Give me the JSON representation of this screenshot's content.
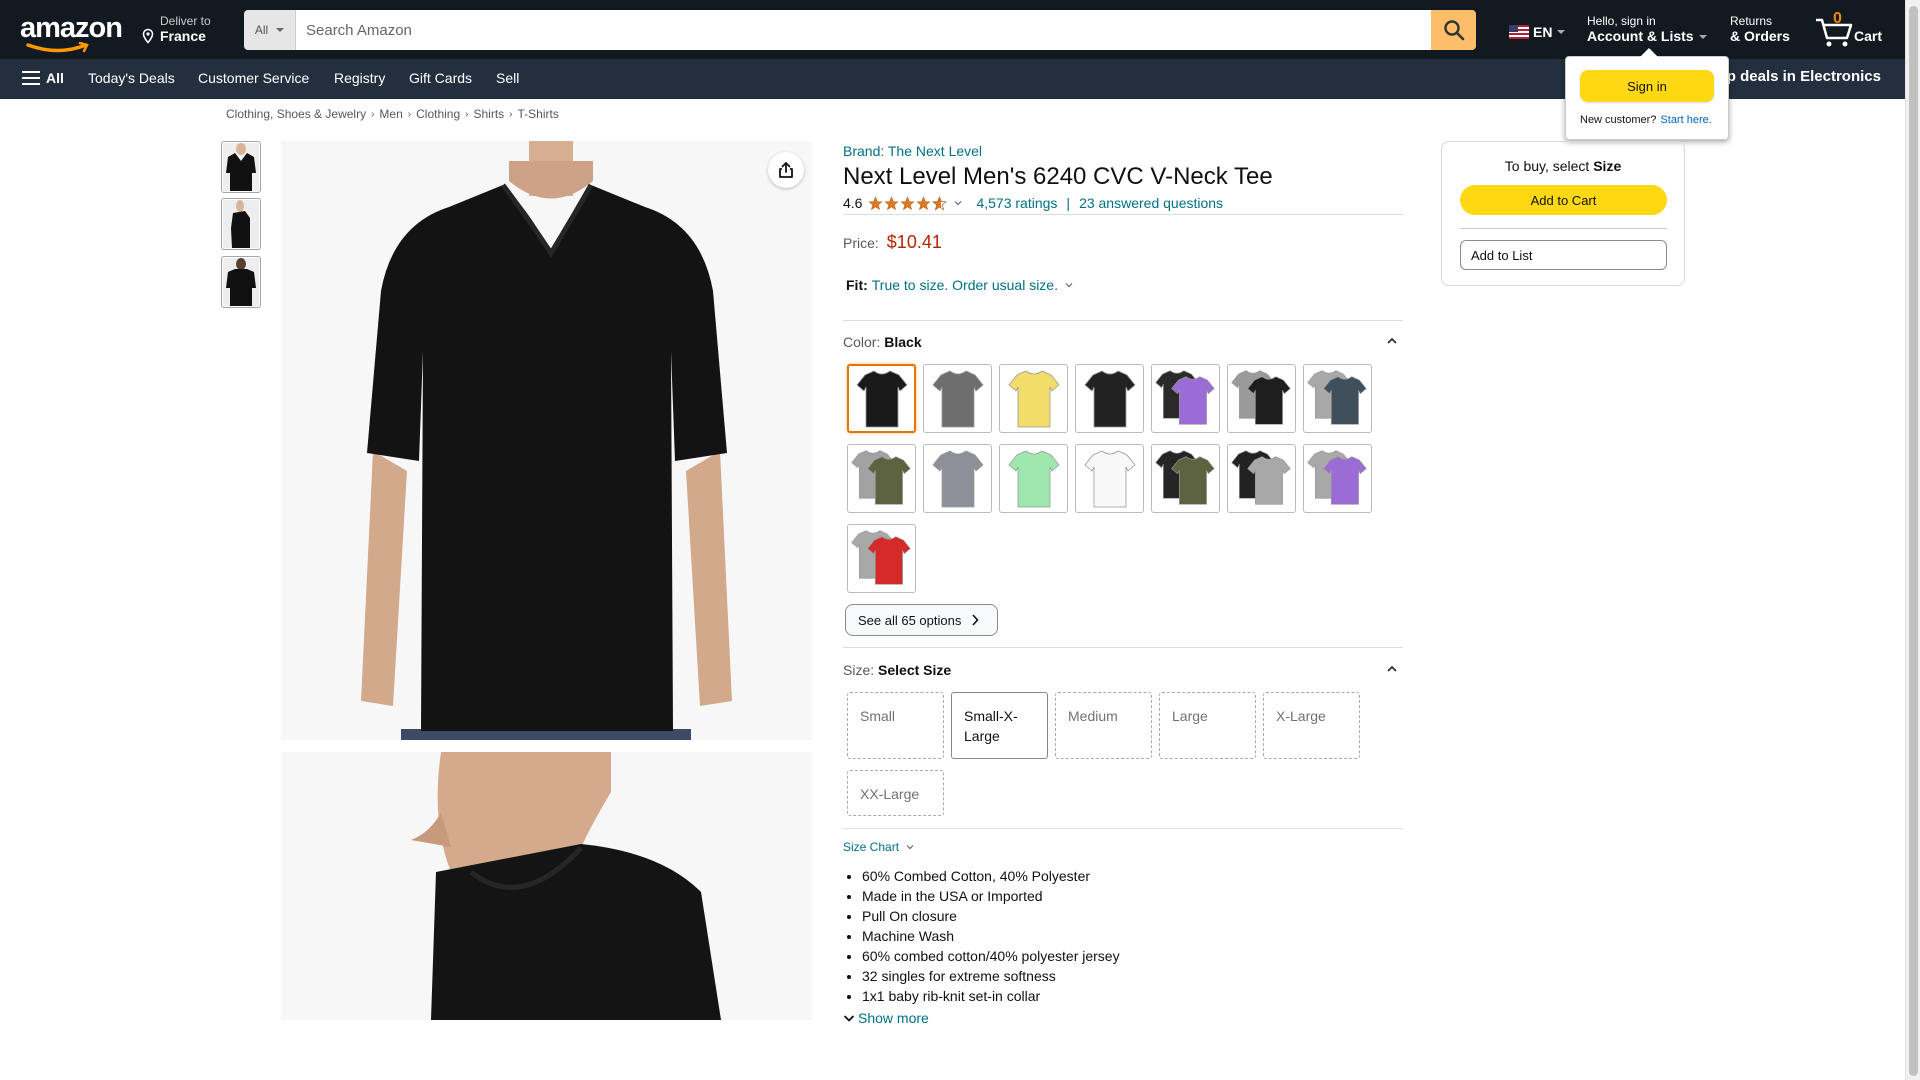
{
  "header": {
    "deliver_line1": "Deliver to",
    "deliver_line2": "France",
    "search_category": "All",
    "search_placeholder": "Search Amazon",
    "language": "EN",
    "account_line1": "Hello, sign in",
    "account_line2": "Account & Lists",
    "returns_line1": "Returns",
    "returns_line2": "& Orders",
    "cart_count": "0",
    "cart_label": "Cart"
  },
  "subnav": {
    "all_label": "All",
    "links": [
      "Today's Deals",
      "Customer Service",
      "Registry",
      "Gift Cards",
      "Sell"
    ],
    "promo": "Shop deals in Electronics"
  },
  "flyout": {
    "signin_label": "Sign in",
    "new_customer": "New customer?",
    "start_here": "Start here."
  },
  "breadcrumb": [
    "Clothing, Shoes & Jewelry",
    "Men",
    "Clothing",
    "Shirts",
    "T-Shirts"
  ],
  "product": {
    "brand": "Brand: The Next Level",
    "title": "Next Level Men's 6240 CVC V-Neck Tee",
    "rating": "4.6",
    "rating_value": 4.6,
    "ratings_count": "4,573 ratings",
    "answered": "23 answered questions",
    "price_label": "Price:",
    "price": "$10.41",
    "fit_label": "Fit:",
    "fit_value": "True to size. Order usual size.",
    "color_label": "Color:",
    "color_value": "Black",
    "see_all": "See all 65 options",
    "size_label": "Size:",
    "size_value": "Select Size",
    "sizes": [
      "Small",
      "Small-X-Large",
      "Medium",
      "Large",
      "X-Large",
      "XX-Large"
    ],
    "size_chart": "Size Chart",
    "bullets": [
      "60% Combed Cotton, 40% Polyester",
      "Made in the USA or Imported",
      "Pull On closure",
      "Machine Wash",
      "60% combed cotton/40% polyester jersey",
      "32 singles for extreme softness",
      "1x1 baby rib-knit set-in collar"
    ],
    "show_more": "Show more"
  },
  "swatch_colors": [
    [
      "#1a1a1a"
    ],
    [
      "#6e6e6e"
    ],
    [
      "#f2dd6a"
    ],
    [
      "#222222"
    ],
    [
      "#2a2a2a",
      "#9b6bd6"
    ],
    [
      "#9a9a9a",
      "#1e1e1e"
    ],
    [
      "#a8a8a8",
      "#3f4f5c"
    ],
    [
      "#a2a2a2",
      "#5d6340"
    ],
    [
      "#8e9099"
    ],
    [
      "#9ee8b0"
    ],
    [
      "#f8f8f8"
    ],
    [
      "#252525",
      "#5d6340"
    ],
    [
      "#222222",
      "#a8a8a8"
    ],
    [
      "#a8a8a8",
      "#9b6bd6"
    ],
    [
      "#a8a8a8",
      "#d42a2a"
    ]
  ],
  "buybox": {
    "to_buy": "To buy, select",
    "to_buy_bold": "Size",
    "add_to_cart": "Add to Cart",
    "add_to_list": "Add to List"
  },
  "colors": {
    "nav_bg": "#131921",
    "subnav_bg": "#232f3e",
    "accent_yellow": "#ffd814",
    "search_button": "#febd69",
    "price_red": "#b12704",
    "link_teal": "#007185",
    "selected_orange": "#e77600"
  }
}
